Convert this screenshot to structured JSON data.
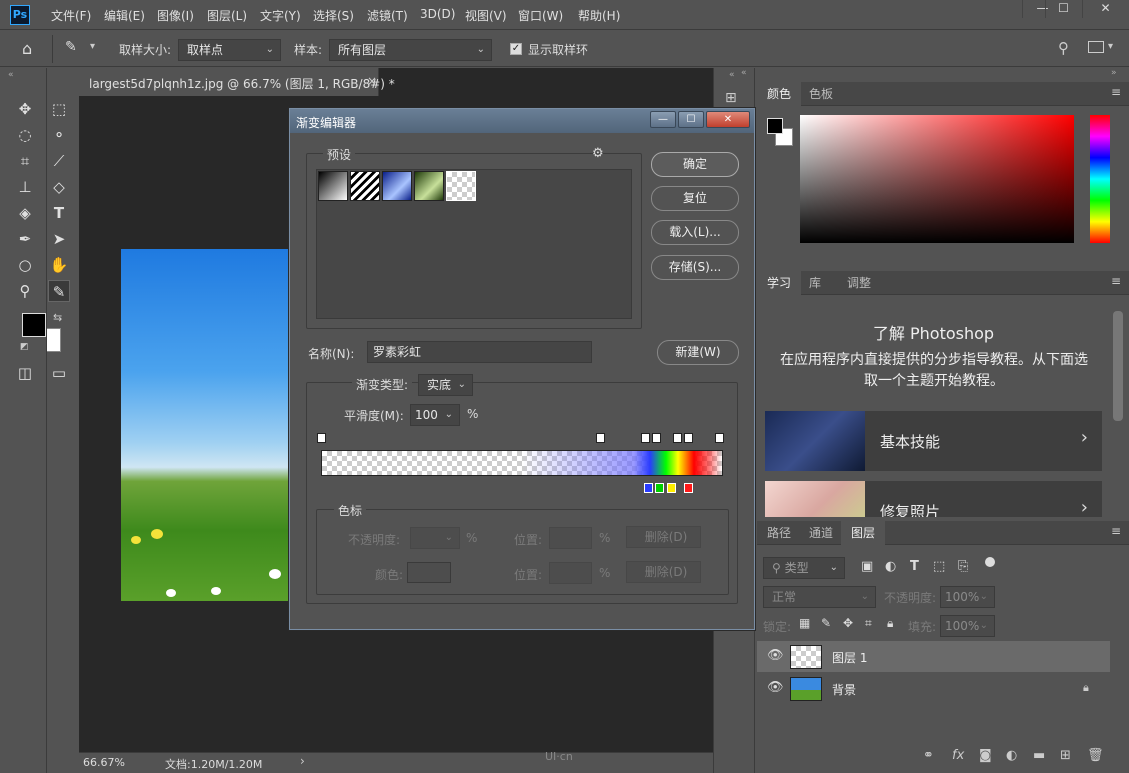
{
  "menu": {
    "logo": "Ps",
    "items": [
      "文件(F)",
      "编辑(E)",
      "图像(I)",
      "图层(L)",
      "文字(Y)",
      "选择(S)",
      "滤镜(T)",
      "3D(D)",
      "视图(V)",
      "窗口(W)",
      "帮助(H)"
    ]
  },
  "options": {
    "sample_size_label": "取样大小:",
    "sample_size_value": "取样点",
    "sample_label": "样本:",
    "sample_value": "所有图层",
    "show_ring_label": "显示取样环"
  },
  "document": {
    "tab_label": "largest5d7plqnh1z.jpg @ 66.7% (图层 1, RGB/8#) *",
    "zoom": "66.67%",
    "doc_info": "文档:1.20M/1.20M"
  },
  "color_panel": {
    "tabs": [
      "颜色",
      "色板"
    ]
  },
  "learn_panel": {
    "tabs": [
      "学习",
      "库",
      "调整"
    ],
    "title": "了解 Photoshop",
    "description": "在应用程序内直接提供的分步指导教程。从下面选取一个主题开始教程。",
    "cards": [
      "基本技能",
      "修复照片"
    ]
  },
  "layers_panel": {
    "tabs": [
      "路径",
      "通道",
      "图层"
    ],
    "filter_kind": "类型",
    "blend_mode": "正常",
    "opacity_label": "不透明度:",
    "opacity_value": "100%",
    "lock_label": "锁定:",
    "fill_label": "填充:",
    "fill_value": "100%",
    "layers": [
      {
        "name": "图层 1"
      },
      {
        "name": "背景"
      }
    ]
  },
  "gradient_editor": {
    "title": "渐变编辑器",
    "presets_label": "预设",
    "buttons": {
      "ok": "确定",
      "reset": "复位",
      "load": "载入(L)...",
      "save": "存储(S)...",
      "new": "新建(W)"
    },
    "name_label": "名称(N):",
    "name_value": "罗素彩虹",
    "type_label": "渐变类型:",
    "type_value": "实底",
    "smoothness_label": "平滑度(M):",
    "smoothness_value": "100",
    "percent": "%",
    "stops_group": "色标",
    "opacity_label": "不透明度:",
    "position_label": "位置:",
    "delete_label": "删除(D)",
    "color_label": "颜色:"
  },
  "watermark": "UI·cn"
}
